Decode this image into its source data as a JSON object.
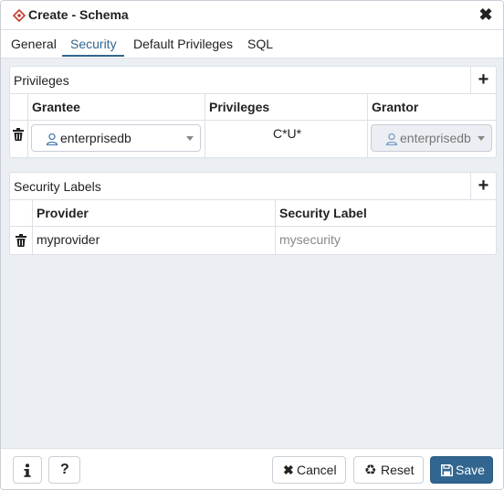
{
  "dialog": {
    "title": "Create - Schema",
    "close_icon": "close-icon"
  },
  "tabs": [
    {
      "label": "General"
    },
    {
      "label": "Security",
      "active": true
    },
    {
      "label": "Default Privileges"
    },
    {
      "label": "SQL"
    }
  ],
  "privileges": {
    "title": "Privileges",
    "add_icon": "plus-icon",
    "columns": [
      "Grantee",
      "Privileges",
      "Grantor"
    ],
    "rows": [
      {
        "grantee": "enterprisedb",
        "privileges": "C*U*",
        "grantor": "enterprisedb"
      }
    ]
  },
  "security_labels": {
    "title": "Security Labels",
    "add_icon": "plus-icon",
    "columns": [
      "Provider",
      "Security Label"
    ],
    "rows": [
      {
        "provider": "myprovider",
        "label": "mysecurity"
      }
    ]
  },
  "footer": {
    "info_icon": "info-icon",
    "help_label": "?",
    "cancel_label": "Cancel",
    "reset_label": "Reset",
    "save_label": "Save"
  },
  "colors": {
    "accent": "#326690",
    "body_bg": "#ebeef3",
    "border": "#dde0e6"
  }
}
